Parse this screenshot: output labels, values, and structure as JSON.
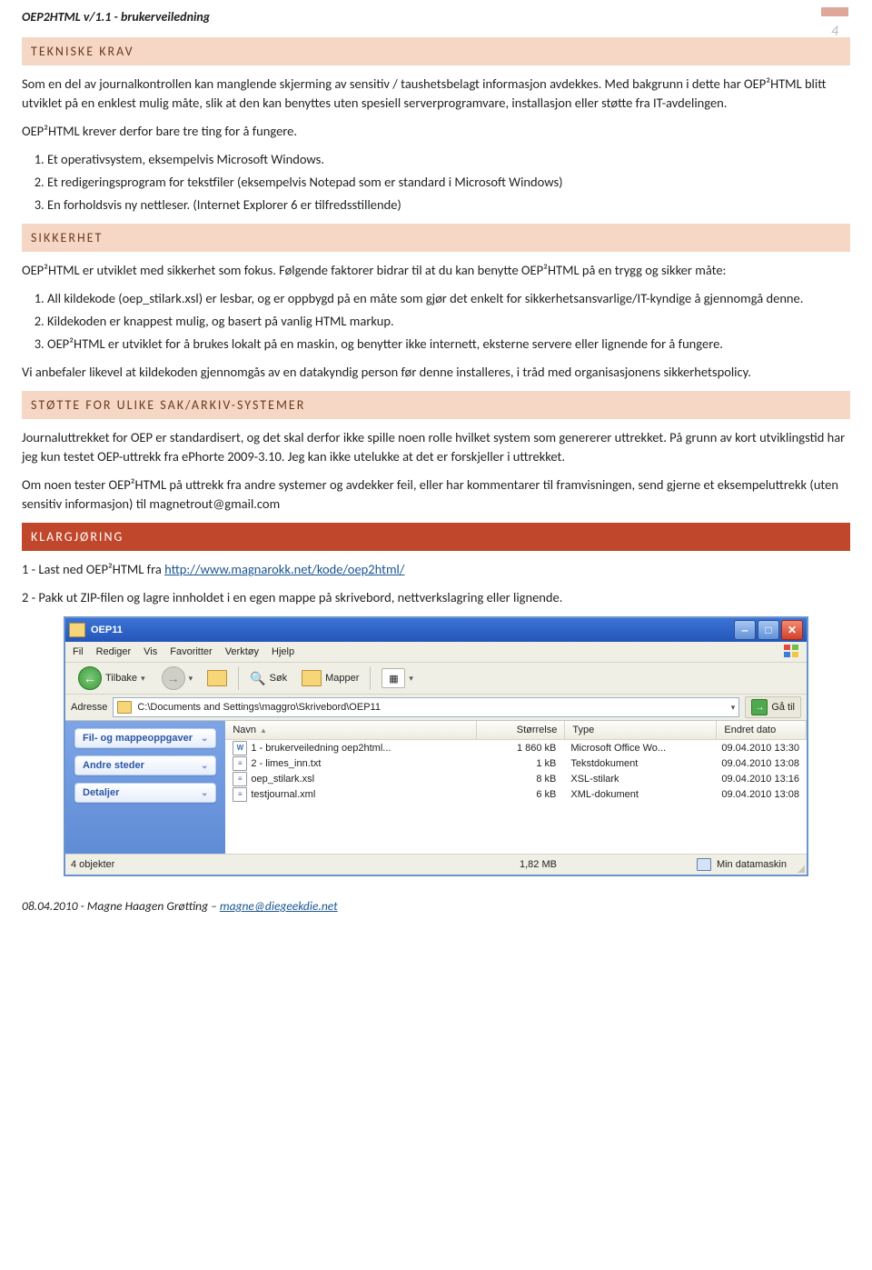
{
  "doc_header": "OEP2HTML v/1.1 - brukerveiledning",
  "page_number": "4",
  "sections": {
    "tekniske_krav": {
      "heading": "TEKNISKE KRAV",
      "p1": "Som en del av journalkontrollen kan manglende skjerming av sensitiv / taushetsbelagt informasjon avdekkes. Med bakgrunn i dette har OEP²HTML blitt utviklet på en enklest mulig måte, slik at den kan benyttes uten spesiell serverprogramvare, installasjon eller støtte fra IT-avdelingen.",
      "p2": "OEP²HTML krever derfor bare tre ting for å fungere.",
      "list": [
        "Et operativsystem, eksempelvis Microsoft Windows.",
        "Et redigeringsprogram for tekstfiler (eksempelvis Notepad som er standard i Microsoft Windows)",
        "En forholdsvis ny nettleser. (Internet Explorer 6 er tilfredsstillende)"
      ]
    },
    "sikkerhet": {
      "heading": "SIKKERHET",
      "p1_a": "OEP²HTML er utviklet med sikkerhet som fokus. Følgende faktorer bidrar til at du kan benytte OEP²HTML på en trygg og sikker måte:",
      "list": [
        "All kildekode (oep_stilark.xsl) er lesbar, og er oppbygd på en måte som gjør det enkelt for sikkerhetsansvarlige/IT-kyndige å gjennomgå denne.",
        "Kildekoden er knappest mulig, og basert på vanlig HTML markup.",
        "OEP²HTML er utviklet for å brukes lokalt på en maskin, og benytter ikke internett, eksterne servere eller lignende for å fungere."
      ],
      "p2": "Vi anbefaler likevel at kildekoden gjennomgås av en datakyndig person før denne installeres, i tråd med organisasjonens sikkerhetspolicy."
    },
    "stotte": {
      "heading": "STØTTE FOR ULIKE SAK/ARKIV-SYSTEMER",
      "p1": "Journaluttrekket for OEP er standardisert, og det skal derfor ikke spille noen rolle hvilket system som genererer uttrekket. På grunn av kort utviklingstid har jeg kun testet OEP-uttrekk fra ePhorte 2009-3.10. Jeg kan ikke utelukke at det er forskjeller i uttrekket.",
      "p2": "Om noen tester OEP²HTML på uttrekk fra andre systemer og avdekker feil, eller har kommentarer til framvisningen, send gjerne et eksempeluttrekk (uten sensitiv informasjon) til magnetrout@gmail.com"
    },
    "klargjoring": {
      "heading": "KLARGJØRING",
      "step1_a": "1 - Last ned OEP²HTML fra ",
      "step1_link": "http://www.magnarokk.net/kode/oep2html/",
      "step2": "2 - Pakk ut ZIP-filen og lagre innholdet i en egen mappe på skrivebord, nettverkslagring eller lignende."
    }
  },
  "explorer": {
    "title": "OEP11",
    "menu": [
      "Fil",
      "Rediger",
      "Vis",
      "Favoritter",
      "Verktøy",
      "Hjelp"
    ],
    "toolbar": {
      "back": "Tilbake",
      "search": "Søk",
      "folders": "Mapper"
    },
    "address_label": "Adresse",
    "address_path": "C:\\Documents and Settings\\maggro\\Skrivebord\\OEP11",
    "go": "Gå til",
    "side": {
      "tasks": "Fil- og mappeoppgaver",
      "other": "Andre steder",
      "details": "Detaljer"
    },
    "columns": {
      "name": "Navn",
      "size": "Størrelse",
      "type": "Type",
      "date": "Endret dato"
    },
    "files": [
      {
        "name": "1 - brukerveiledning oep2html...",
        "size": "1 860 kB",
        "type": "Microsoft Office Wo...",
        "date": "09.04.2010 13:30",
        "icon": "W"
      },
      {
        "name": "2 - limes_inn.txt",
        "size": "1 kB",
        "type": "Tekstdokument",
        "date": "09.04.2010 13:08",
        "icon": "≡"
      },
      {
        "name": "oep_stilark.xsl",
        "size": "8 kB",
        "type": "XSL-stilark",
        "date": "09.04.2010 13:16",
        "icon": "≡"
      },
      {
        "name": "testjournal.xml",
        "size": "6 kB",
        "type": "XML-dokument",
        "date": "09.04.2010 13:08",
        "icon": "≡"
      }
    ],
    "status": {
      "objects": "4 objekter",
      "size": "1,82 MB",
      "location": "Min datamaskin"
    }
  },
  "footer": {
    "prefix": "08.04.2010 - Magne Haagen Grøtting – ",
    "email": "magne@diegeekdie.net"
  }
}
